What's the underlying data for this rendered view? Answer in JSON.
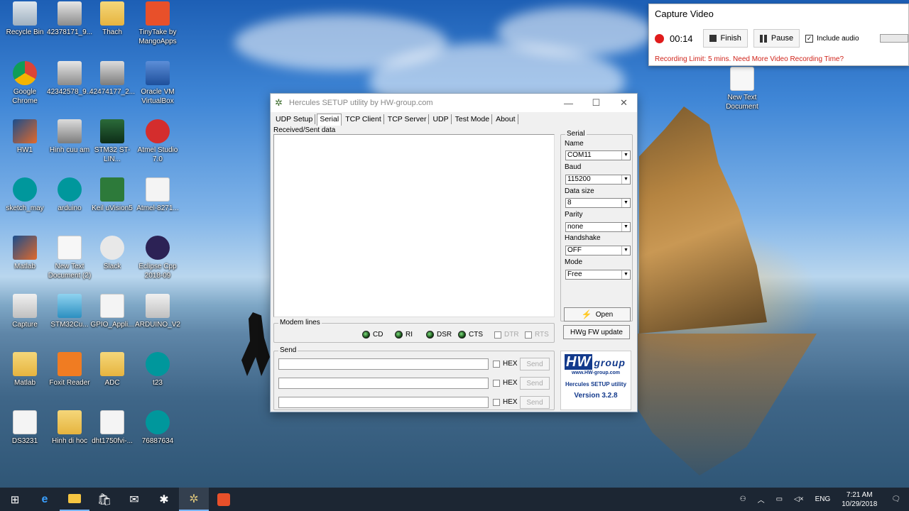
{
  "desktop": {
    "icons": [
      {
        "label": "Recycle Bin",
        "icon": "recycle-bin-icon"
      },
      {
        "label": "42378171_9...",
        "icon": "printer-icon"
      },
      {
        "label": "Thach",
        "icon": "folder-icon"
      },
      {
        "label": "TinyTake by MangoApps",
        "icon": "tinytake-icon"
      },
      {
        "label": "Google Chrome",
        "icon": "chrome-icon"
      },
      {
        "label": "42342578_9...",
        "icon": "printer-icon"
      },
      {
        "label": "42474177_2...",
        "icon": "file-icon"
      },
      {
        "label": "Oracle VM VirtualBox",
        "icon": "virtualbox-icon"
      },
      {
        "label": "HW1",
        "icon": "matlab-icon"
      },
      {
        "label": "Hinh cuu am",
        "icon": "file-icon"
      },
      {
        "label": "STM32 ST-LIN...",
        "icon": "stm32-icon"
      },
      {
        "label": "Atmel Studio 7.0",
        "icon": "atmel-icon"
      },
      {
        "label": "sketch_may",
        "icon": "arduino-icon"
      },
      {
        "label": "arduino",
        "icon": "arduino-icon"
      },
      {
        "label": "Keil uVision5",
        "icon": "keil-icon"
      },
      {
        "label": "Atmel-8271...",
        "icon": "pdf-icon"
      },
      {
        "label": "Matlab",
        "icon": "matlab-icon"
      },
      {
        "label": "New Text Document (2)",
        "icon": "text-document-icon"
      },
      {
        "label": "Slack",
        "icon": "slack-icon"
      },
      {
        "label": "Eclipse Cpp 2018-09",
        "icon": "eclipse-icon"
      },
      {
        "label": "Capture",
        "icon": "image-icon"
      },
      {
        "label": "STM32Cu...",
        "icon": "stm32cube-icon"
      },
      {
        "label": "GPIO_Appli...",
        "icon": "pdf-icon"
      },
      {
        "label": "ARDUINO_V2",
        "icon": "image-icon"
      },
      {
        "label": "Matlab",
        "icon": "folder-icon"
      },
      {
        "label": "Foxit Reader",
        "icon": "foxit-icon"
      },
      {
        "label": "ADC",
        "icon": "folder-icon"
      },
      {
        "label": "t23",
        "icon": "arduino-icon"
      },
      {
        "label": "DS3231",
        "icon": "pdf-icon"
      },
      {
        "label": "Hinh di hoc",
        "icon": "folder-icon"
      },
      {
        "label": "dht1750fvi-...",
        "icon": "pdf-icon"
      },
      {
        "label": "76887634",
        "icon": "arduino-icon"
      },
      {
        "label": "New Text Document",
        "icon": "text-document-icon"
      }
    ]
  },
  "capture": {
    "title": "Capture Video",
    "timer": "00:14",
    "finish_label": "Finish",
    "pause_label": "Pause",
    "include_audio_label": "Include audio",
    "include_audio_checked": "✓",
    "limit_text": "Recording Limit: 5 mins. Need More Video Recording Time?"
  },
  "hercules": {
    "title": "Hercules SETUP utility by HW-group.com",
    "tabs": [
      "UDP Setup",
      "Serial",
      "TCP Client",
      "TCP Server",
      "UDP",
      "Test Mode",
      "About"
    ],
    "active_tab": "Serial",
    "received_label": "Received/Sent data",
    "serial": {
      "group_label": "Serial",
      "name_label": "Name",
      "name_value": "COM11",
      "baud_label": "Baud",
      "baud_value": "115200",
      "datasize_label": "Data size",
      "datasize_value": "8",
      "parity_label": "Parity",
      "parity_value": "none",
      "handshake_label": "Handshake",
      "handshake_value": "OFF",
      "mode_label": "Mode",
      "mode_value": "Free"
    },
    "open_label": "Open",
    "fw_update_label": "HWg FW update",
    "modem": {
      "group_label": "Modem lines",
      "leds": [
        "CD",
        "RI",
        "DSR",
        "CTS"
      ],
      "checks": [
        "DTR",
        "RTS"
      ]
    },
    "send": {
      "group_label": "Send",
      "hex_label": "HEX",
      "send_label": "Send"
    },
    "logo": {
      "brand_a": "HW",
      "brand_b": "group",
      "url": "www.HW-group.com",
      "product": "Hercules SETUP utility",
      "version": "Version  3.2.8"
    }
  },
  "taskbar": {
    "language": "ENG",
    "time": "7:21 AM",
    "date": "10/29/2018"
  }
}
